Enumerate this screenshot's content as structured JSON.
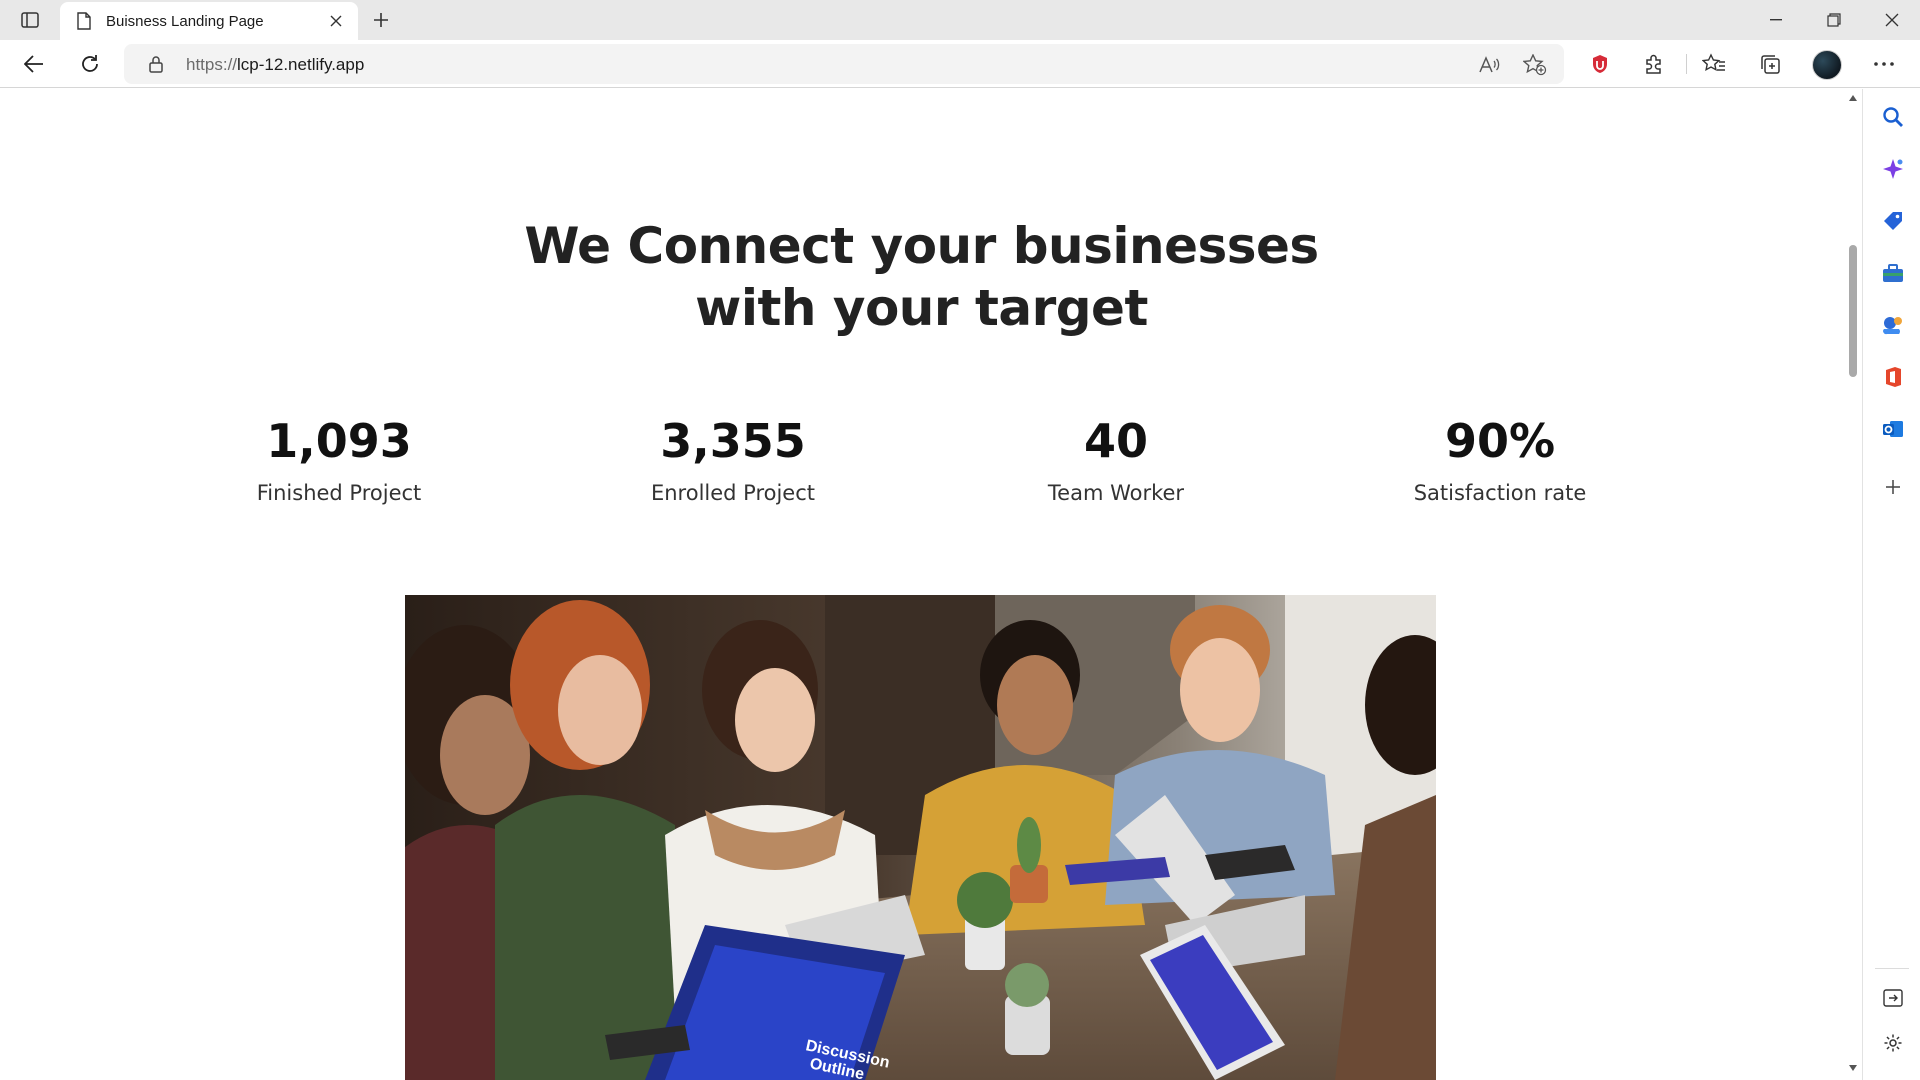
{
  "browser": {
    "tab_title": "Buisness Landing Page",
    "url_protocol": "https://",
    "url_host": "lcp-12.netlify.app"
  },
  "page": {
    "headline_line1": "We Connect your businesses",
    "headline_line2": "with your target",
    "stats": [
      {
        "value": "1,093",
        "label": "Finished Project"
      },
      {
        "value": "3,355",
        "label": "Enrolled Project"
      },
      {
        "value": "40",
        "label": "Team Worker"
      },
      {
        "value": "90%",
        "label": "Satisfaction rate"
      }
    ],
    "photo_alt": "Team of people working together at a table with laptops",
    "laptop_screen_text_1": "Discussion",
    "laptop_screen_text_2": "Outline"
  },
  "colors": {
    "heading": "#222222",
    "stat_number": "#111111",
    "stat_label": "#333333",
    "chrome_bg": "#e8e8e8",
    "address_bg": "#f3f3f3"
  },
  "icons": {
    "tab_actions": "tab-actions-icon",
    "page": "page-icon",
    "close": "close-icon",
    "new_tab": "plus-icon",
    "back": "back-arrow-icon",
    "refresh": "refresh-icon",
    "lock": "lock-icon",
    "read_aloud": "read-aloud-icon",
    "favorite": "star-add-icon",
    "extension_shield": "shield-extension-icon",
    "extensions": "puzzle-icon",
    "favorites": "favorites-icon",
    "collections": "collections-icon",
    "more": "more-icon",
    "sidebar": [
      "search-icon",
      "copilot-icon",
      "shopping-tag-icon",
      "tools-icon",
      "games-icon",
      "office-icon",
      "outlook-icon",
      "add-icon",
      "split-screen-icon",
      "settings-icon"
    ]
  }
}
